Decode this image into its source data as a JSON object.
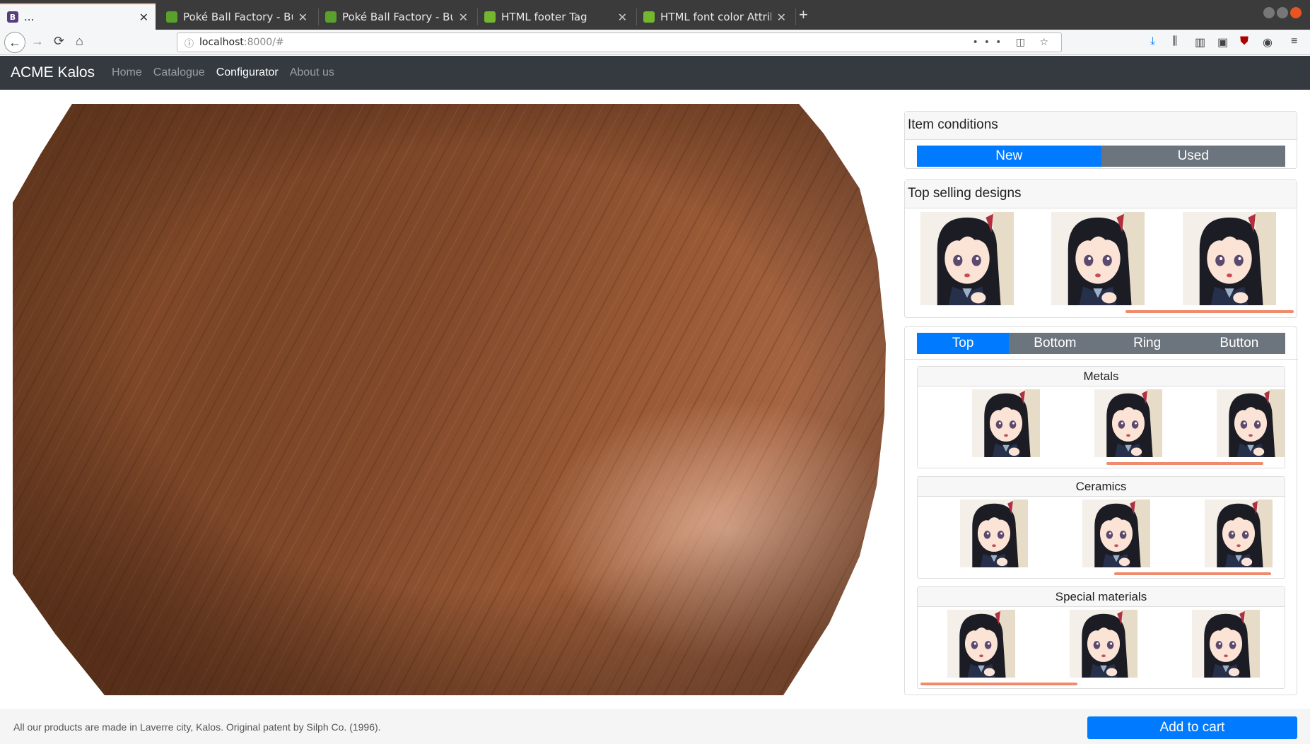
{
  "browser": {
    "tabs": [
      {
        "title": "...",
        "favicon": "B",
        "favicon_color": "#563d7c",
        "active": true
      },
      {
        "title": "Poké Ball Factory - Bulba",
        "favicon": "",
        "favicon_color": "#5aa02c",
        "active": false
      },
      {
        "title": "Poké Ball Factory - Bulba",
        "favicon": "",
        "favicon_color": "#5aa02c",
        "active": false
      },
      {
        "title": "HTML footer Tag",
        "favicon": "",
        "favicon_color": "#74b72e",
        "active": false
      },
      {
        "title": "HTML font color Attribu",
        "favicon": "",
        "favicon_color": "#74b72e",
        "active": false
      }
    ],
    "url_host": "localhost",
    "url_rest": ":8000/#"
  },
  "site": {
    "brand": "ACME Kalos",
    "nav": [
      {
        "label": "Home",
        "active": false
      },
      {
        "label": "Catalogue",
        "active": false
      },
      {
        "label": "Configurator",
        "active": true
      },
      {
        "label": "About us",
        "active": false
      }
    ]
  },
  "panel": {
    "conditions": {
      "title": "Item conditions",
      "options": [
        {
          "label": "New",
          "selected": true
        },
        {
          "label": "Used",
          "selected": false
        }
      ]
    },
    "top_selling": {
      "title": "Top selling designs",
      "thumbnails": 3
    },
    "parts": {
      "tabs": [
        {
          "label": "Top",
          "selected": true
        },
        {
          "label": "Bottom",
          "selected": false
        },
        {
          "label": "Ring",
          "selected": false
        },
        {
          "label": "Button",
          "selected": false
        }
      ],
      "sections": [
        {
          "title": "Metals"
        },
        {
          "title": "Ceramics"
        },
        {
          "title": "Special materials"
        }
      ]
    }
  },
  "footer": {
    "text": "All our products are made in Laverre city, Kalos. Original patent by Silph Co. (1996).",
    "cart_label": "Add to cart"
  },
  "colors": {
    "primary": "#007bff",
    "secondary": "#6c757d",
    "navbar": "#343a40",
    "scroll_indicator": "#ef8b6c",
    "wood": "#8a4f2c"
  }
}
